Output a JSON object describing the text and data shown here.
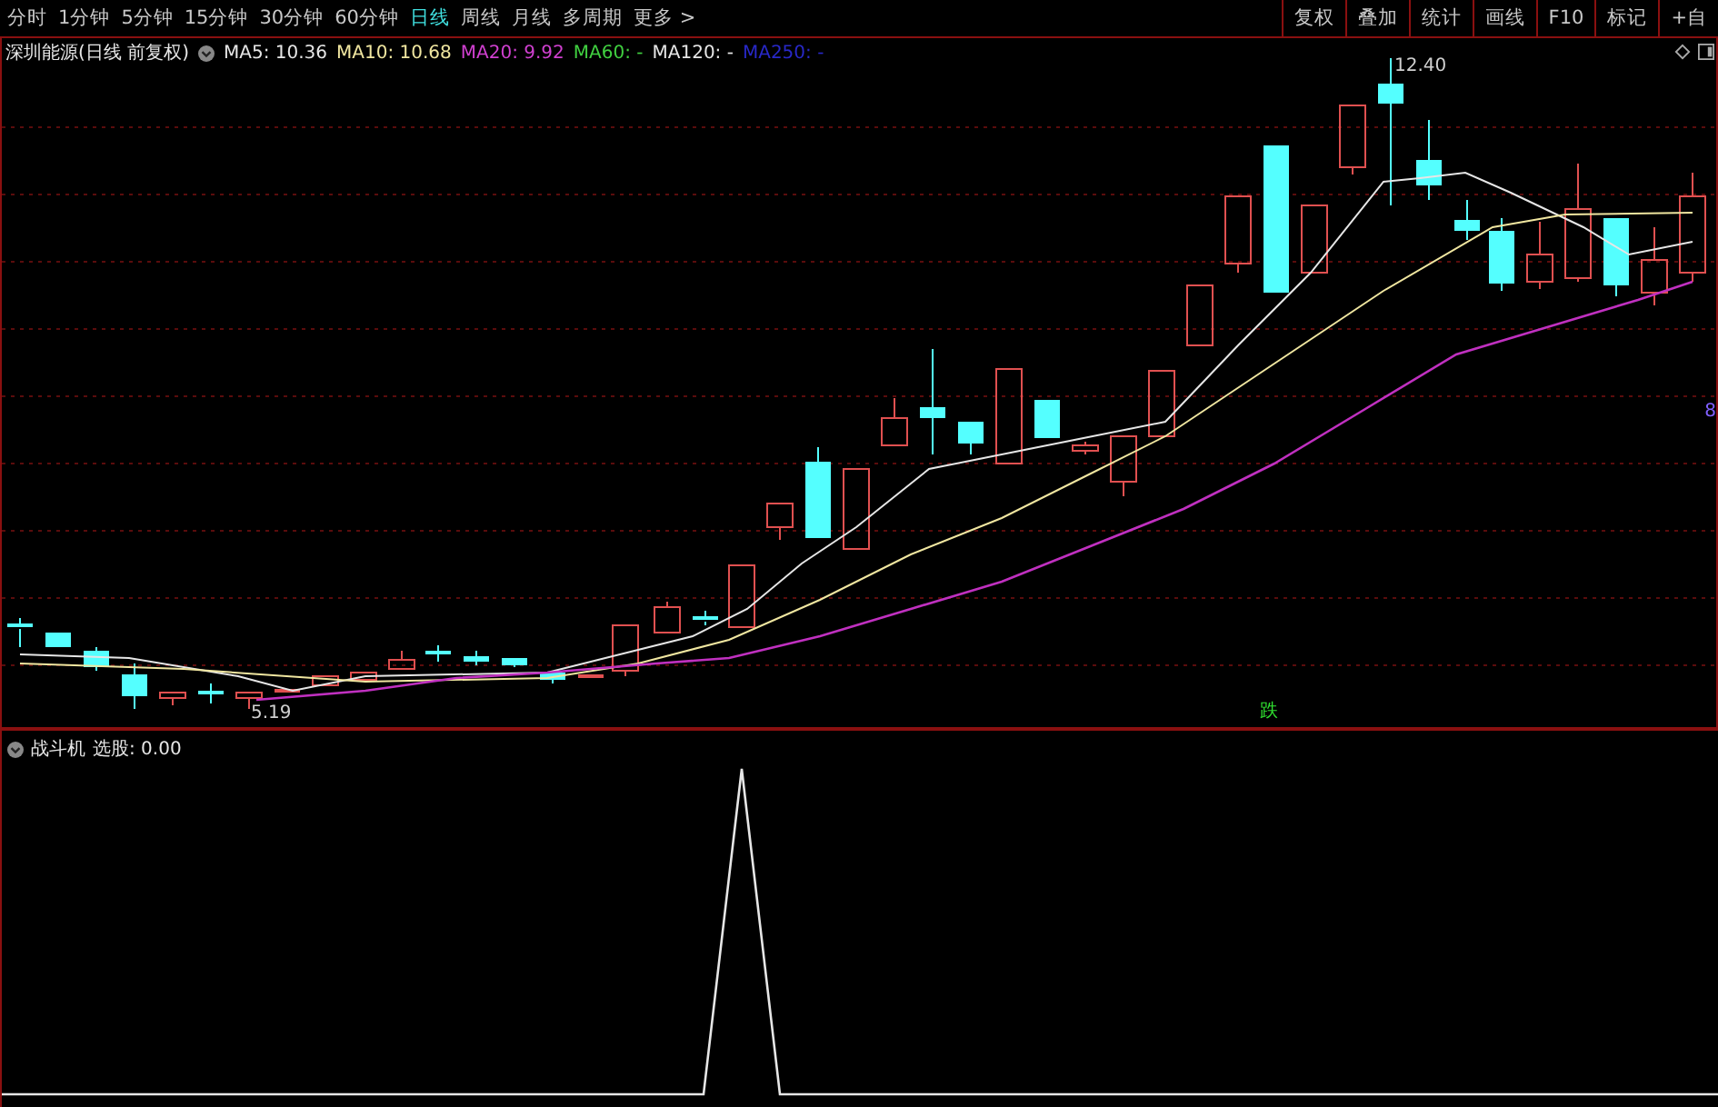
{
  "period_tabs": [
    {
      "label": "分时",
      "selected": false
    },
    {
      "label": "1分钟",
      "selected": false
    },
    {
      "label": "5分钟",
      "selected": false
    },
    {
      "label": "15分钟",
      "selected": false
    },
    {
      "label": "30分钟",
      "selected": false
    },
    {
      "label": "60分钟",
      "selected": false
    },
    {
      "label": "日线",
      "selected": true
    },
    {
      "label": "周线",
      "selected": false
    },
    {
      "label": "月线",
      "selected": false
    },
    {
      "label": "多周期",
      "selected": false
    },
    {
      "label": "更多 >",
      "selected": false
    }
  ],
  "toolbar_buttons": [
    "复权",
    "叠加",
    "统计",
    "画线",
    "F10",
    "标记",
    "+自"
  ],
  "legend": {
    "title": "深圳能源(日线 前复权)",
    "averages": [
      {
        "label": "MA5: 10.36",
        "color": "#e6e6e6"
      },
      {
        "label": "MA10: 10.68",
        "color": "#f0e6a0"
      },
      {
        "label": "MA20: 9.92",
        "color": "#d040d0"
      },
      {
        "label": "MA60: -",
        "color": "#40d040"
      },
      {
        "label": "MA120: -",
        "color": "#e6e6e6"
      },
      {
        "label": "MA250: -",
        "color": "#2828c8"
      }
    ]
  },
  "price_chart": {
    "high_label": "12.40",
    "low_label": "5.19",
    "signal_label": "跌",
    "axis_edge_label": "8"
  },
  "indicator": {
    "title": "战斗机",
    "reading": "选股: 0.00"
  }
}
